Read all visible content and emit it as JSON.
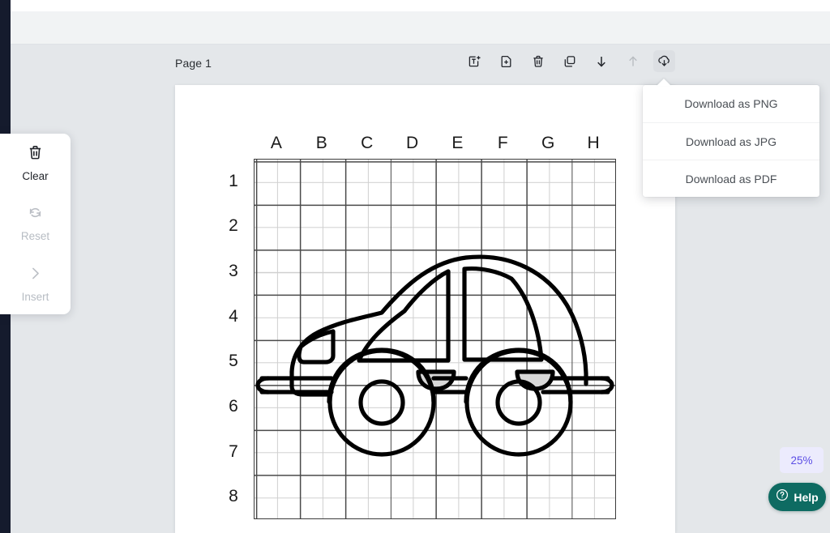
{
  "app": {
    "dark_rail_color": "#151b2d",
    "header_color": "#f1f3f4",
    "workspace_color": "#e4e7ea"
  },
  "page_toolbar": {
    "page_label": "Page 1",
    "icons": [
      {
        "name": "add-text-icon",
        "title": "Add text",
        "state": "enabled"
      },
      {
        "name": "add-page-icon",
        "title": "Add page",
        "state": "enabled"
      },
      {
        "name": "delete-icon",
        "title": "Delete",
        "state": "enabled"
      },
      {
        "name": "duplicate-icon",
        "title": "Duplicate",
        "state": "enabled"
      },
      {
        "name": "move-down-icon",
        "title": "Move down",
        "state": "enabled"
      },
      {
        "name": "move-up-icon",
        "title": "Move up",
        "state": "disabled"
      },
      {
        "name": "download-icon",
        "title": "Download",
        "state": "active"
      }
    ]
  },
  "download_menu": {
    "visible": true,
    "items": [
      {
        "label": "Download as PNG"
      },
      {
        "label": "Download as JPG"
      },
      {
        "label": "Download as PDF"
      }
    ]
  },
  "tool_panel": {
    "items": [
      {
        "label": "Clear",
        "icon": "trash-icon",
        "state": "enabled"
      },
      {
        "label": "Reset",
        "icon": "reset-icon",
        "state": "disabled"
      },
      {
        "label": "Insert",
        "icon": "chevron-right-icon",
        "state": "disabled"
      }
    ]
  },
  "grid": {
    "column_labels": [
      "A",
      "B",
      "C",
      "D",
      "E",
      "F",
      "G",
      "H"
    ],
    "row_labels": [
      "1",
      "2",
      "3",
      "4",
      "5",
      "6",
      "7",
      "8"
    ],
    "subdivisions_per_cell": 2,
    "major_line_color": "#4a4a4a",
    "minor_line_color": "#cfcfcf",
    "artwork_name": "cartoon-car-line-drawing",
    "artwork_stroke_color": "#000000"
  },
  "zoom": {
    "level": "25%",
    "background": "#ecebfd",
    "text_color": "#5c4ee5"
  },
  "help": {
    "label": "Help",
    "icon": "question-mark-icon",
    "background": "#0e6b62"
  }
}
